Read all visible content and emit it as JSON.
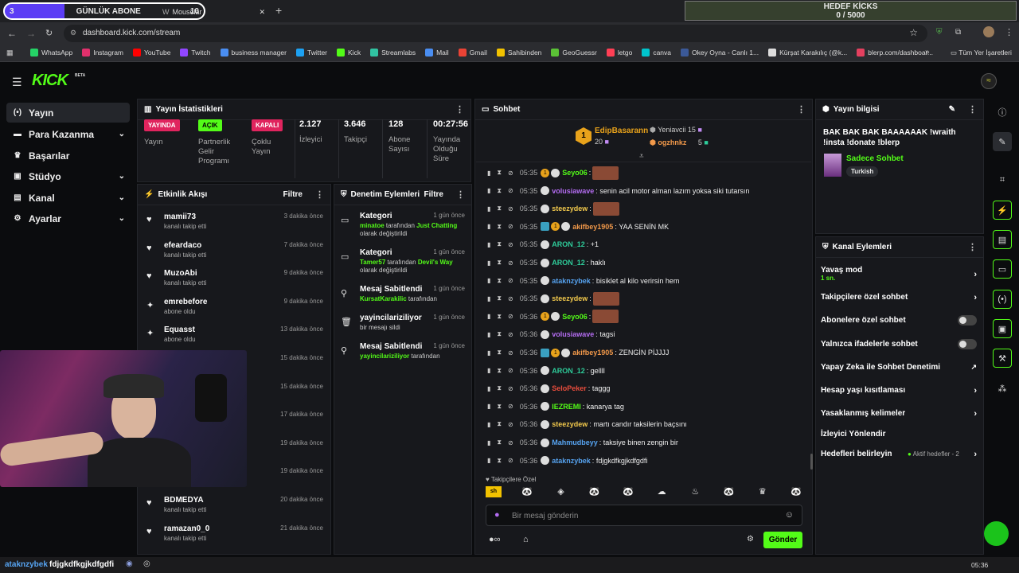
{
  "browser": {
    "tab1_count": "3",
    "tab1_label": "GÜNLÜK ABONE",
    "tab1_value": "10",
    "tab2_label": "Mouselar",
    "goal_title": "HEDEF KİCKS",
    "goal_value": "0 / 5000",
    "url": "dashboard.kick.com/stream",
    "bookmarks": [
      "WhatsApp",
      "Instagram",
      "YouTube",
      "Twitch",
      "business manager",
      "Twitter",
      "Kick",
      "Streamlabs",
      "Mail",
      "Gmail",
      "Sahibinden",
      "GeoGuessr",
      "letgo",
      "canva",
      "Okey Oyna - Canlı 1...",
      "Kürşat Karakılıç (@k...",
      "blerp.com/dashboar..."
    ],
    "all_bookmarks": "Tüm Yer İşaretleri"
  },
  "brand": {
    "logo": "KICK",
    "beta": "BETA"
  },
  "nav": [
    {
      "label": "Yayın"
    },
    {
      "label": "Para Kazanma"
    },
    {
      "label": "Başarılar"
    },
    {
      "label": "Stüdyo"
    },
    {
      "label": "Kanal"
    },
    {
      "label": "Ayarlar"
    }
  ],
  "stats": {
    "title": "Yayın İstatistikleri",
    "stream_badge": "YAYINDA",
    "stream_label": "Yayın",
    "partner_badge": "AÇIK",
    "partner_label": "Partnerlik Gelir Programı",
    "multi_badge": "KAPALI",
    "multi_label": "Çoklu Yayın",
    "viewers": "2.127",
    "viewers_label": "İzleyici",
    "followers": "3.646",
    "followers_label": "Takipçi",
    "subs": "128",
    "subs_label": "Abone Sayısı",
    "uptime": "00:27:56",
    "uptime_label": "Yayında Olduğu Süre"
  },
  "activity": {
    "title": "Etkinlik Akışı",
    "filter": "Filtre",
    "items": [
      {
        "name": "mamii73",
        "desc": "kanalı takip etti",
        "time": "3 dakika önce",
        "icon": "heart"
      },
      {
        "name": "efeardaco",
        "desc": "kanalı takip etti",
        "time": "7 dakika önce",
        "icon": "heart"
      },
      {
        "name": "MuzoAbi",
        "desc": "kanalı takip etti",
        "time": "9 dakika önce",
        "icon": "heart"
      },
      {
        "name": "emrebefore",
        "desc": "abone oldu",
        "time": "9 dakika önce",
        "icon": "star"
      },
      {
        "name": "Equasst",
        "desc": "abone oldu",
        "time": "13 dakika önce",
        "icon": "star"
      },
      {
        "name": "",
        "desc": "",
        "time": "15 dakika önce",
        "icon": ""
      },
      {
        "name": "",
        "desc": "",
        "time": "15 dakika önce",
        "icon": ""
      },
      {
        "name": "",
        "desc": "",
        "time": "17 dakika önce",
        "icon": ""
      },
      {
        "name": "",
        "desc": "",
        "time": "19 dakika önce",
        "icon": ""
      },
      {
        "name": "",
        "desc": "",
        "time": "19 dakika önce",
        "icon": ""
      },
      {
        "name": "BDMEDYA",
        "desc": "kanalı takip etti",
        "time": "20 dakika önce",
        "icon": "heart"
      },
      {
        "name": "ramazan0_0",
        "desc": "kanalı takip etti",
        "time": "21 dakika önce",
        "icon": "heart"
      }
    ]
  },
  "moderation": {
    "title": "Denetim Eylemleri",
    "filter": "Filtre",
    "items": [
      {
        "name": "Kategori",
        "time": "1 gün önce",
        "user": "minatoe",
        "mid": " tarafından ",
        "target": "Just Chatting",
        "tail": "olarak değiştirildi"
      },
      {
        "name": "Kategori",
        "time": "1 gün önce",
        "user": "Tamer57",
        "mid": " tarafından ",
        "target": "Devil's Way",
        "tail": "olarak değiştirildi"
      },
      {
        "name": "Mesaj Sabitlendi",
        "time": "1 gün önce",
        "user": "KursatKarakilic",
        "mid": " tarafından",
        "target": "",
        "tail": ""
      },
      {
        "name": "yayincilariziliyor",
        "time": "1 gün önce",
        "user": "",
        "mid": "",
        "target": "",
        "tail": "bir mesajı sildi"
      },
      {
        "name": "Mesaj Sabitlendi",
        "time": "1 gün önce",
        "user": "yayincilariziliyor",
        "mid": " tarafından",
        "target": "",
        "tail": ""
      }
    ]
  },
  "chat": {
    "title": "Sohbet",
    "top1_name": "EdipBasarann",
    "top1_rank": "1",
    "top1_count": "20",
    "top2_name": "Yeniavcii",
    "top2_count": "15",
    "top3_name": "ogzhnkz",
    "top3_count": "5",
    "messages": [
      {
        "time": "05:35",
        "user": "Seyo06",
        "color": "#53fc18",
        "text": "",
        "emote": true,
        "badge": "rank"
      },
      {
        "time": "05:35",
        "user": "volusiawave",
        "color": "#b36cf0",
        "text": "senin acil motor alman lazım yoksa siki tutarsın",
        "emote": false,
        "badge": ""
      },
      {
        "time": "05:35",
        "user": "steezydew",
        "color": "#f2c94c",
        "text": "",
        "emote": true,
        "badge": ""
      },
      {
        "time": "05:35",
        "user": "akifbey1905",
        "color": "#f2994a",
        "text": "YAA SENİN MK",
        "emote": false,
        "badge": "sub"
      },
      {
        "time": "05:35",
        "user": "ARON_12",
        "color": "#2ecc9a",
        "text": "+1",
        "emote": false,
        "badge": ""
      },
      {
        "time": "05:35",
        "user": "ARON_12",
        "color": "#2ecc9a",
        "text": "haklı",
        "emote": false,
        "badge": ""
      },
      {
        "time": "05:35",
        "user": "ataknzybek",
        "color": "#56a3f0",
        "text": "bisiklet al kilo verirsin hem",
        "emote": false,
        "badge": ""
      },
      {
        "time": "05:35",
        "user": "steezydew",
        "color": "#f2c94c",
        "text": "",
        "emote": true,
        "badge": ""
      },
      {
        "time": "05:36",
        "user": "Seyo06",
        "color": "#53fc18",
        "text": "",
        "emote": true,
        "badge": "rank"
      },
      {
        "time": "05:36",
        "user": "volusiawave",
        "color": "#b36cf0",
        "text": "tagsi",
        "emote": false,
        "badge": ""
      },
      {
        "time": "05:36",
        "user": "akifbey1905",
        "color": "#f2994a",
        "text": "ZENGİN PİJJJJ",
        "emote": false,
        "badge": "sub"
      },
      {
        "time": "05:36",
        "user": "ARON_12",
        "color": "#2ecc9a",
        "text": "gellll",
        "emote": false,
        "badge": ""
      },
      {
        "time": "05:36",
        "user": "SeloPeker",
        "color": "#e74c3c",
        "text": "taggg",
        "emote": false,
        "badge": ""
      },
      {
        "time": "05:36",
        "user": "IEZREMI",
        "color": "#53fc18",
        "text": "kanarya tag",
        "emote": false,
        "badge": ""
      },
      {
        "time": "05:36",
        "user": "steezydew",
        "color": "#f2c94c",
        "text": "martı candır taksilerin baçsını",
        "emote": false,
        "badge": ""
      },
      {
        "time": "05:36",
        "user": "Mahmudbeyy",
        "color": "#56a3f0",
        "text": "taksiye binen zengin bir",
        "emote": false,
        "badge": ""
      },
      {
        "time": "05:36",
        "user": "ataknzybek",
        "color": "#56a3f0",
        "text": "fdjgkdfkgjkdfgdfi",
        "emote": false,
        "badge": ""
      }
    ],
    "mode_label": "Takipçilere Özel",
    "input_placeholder": "Bir mesaj gönderin",
    "send_label": "Gönder"
  },
  "stream_info": {
    "title": "Yayın bilgisi",
    "text": "BAK BAK BAK BAAAAAAK !wraith !insta !donate !blerp",
    "category": "Sadece Sohbet",
    "tag": "Turkish"
  },
  "channel_actions": {
    "title": "Kanal Eylemleri",
    "slow_mode": "Yavaş mod",
    "slow_value": "1 sn.",
    "followers_only": "Takipçilere özel sohbet",
    "subs_only": "Abonelere özel sohbet",
    "emotes_only": "Yalnızca ifadelerle sohbet",
    "ai_mod": "Yapay Zeka ile Sohbet Denetimi",
    "age_limit": "Hesap yaşı kısıtlaması",
    "banned_words": "Yasaklanmış kelimeler",
    "redirect": "İzleyici Yönlendir",
    "goals": "Hedefleri belirleyin",
    "goals_status": "Aktif hedefler - 2"
  },
  "taskbar": {
    "overlay_user": "ataknzybek",
    "overlay_text": "fdjgkdfkgjkdfgdfi",
    "clock": "05:36"
  }
}
